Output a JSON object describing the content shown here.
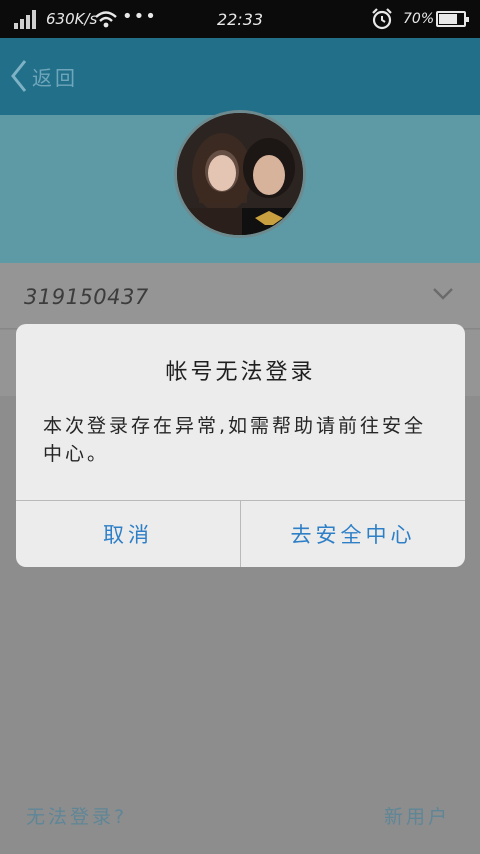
{
  "status_bar": {
    "network_speed": "630K/s",
    "time": "22:33",
    "battery_percent": "70%",
    "battery_level": 0.7,
    "icons": [
      "signal-icon",
      "wifi-icon",
      "more-dots-icon",
      "alarm-icon",
      "battery-icon"
    ]
  },
  "header": {
    "back_label": "返回",
    "back_icon": "chevron-left-icon"
  },
  "login": {
    "account": "319150437",
    "account_dropdown_icon": "chevron-down-icon",
    "password_placeholder": "••••••••••••••"
  },
  "footer": {
    "left_link": "无法登录?",
    "right_link": "新用户"
  },
  "dialog": {
    "title": "帐号无法登录",
    "message": "本次登录存在异常,如需帮助请前往安全中心。",
    "cancel_label": "取消",
    "confirm_label": "去安全中心"
  },
  "colors": {
    "header_bg": "#226f8a",
    "dialog_button_text": "#2f7fc7",
    "dialog_bg": "#ececec"
  }
}
